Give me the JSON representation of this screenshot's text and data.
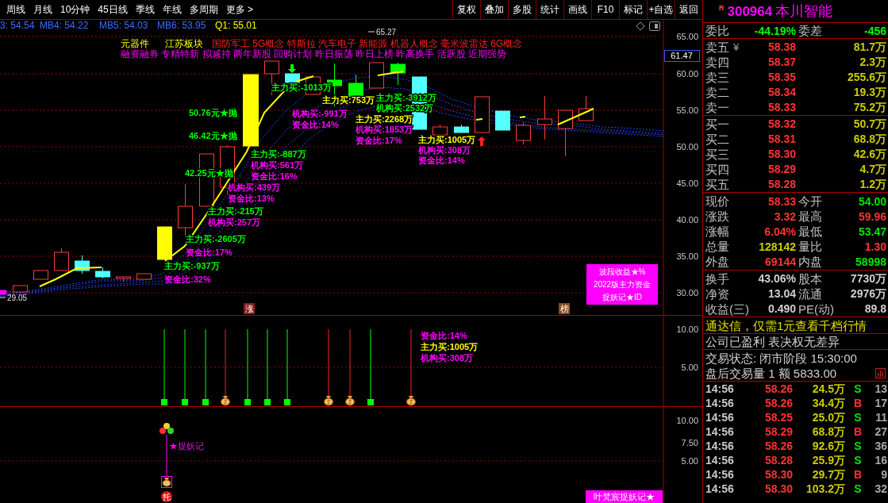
{
  "toolbar": {
    "periods": [
      "周线",
      "月线",
      "10分钟",
      "45日线",
      "季线",
      "年线",
      "多周期",
      "更多 >"
    ],
    "actions": [
      "复权",
      "叠加",
      "多股",
      "统计",
      "画线",
      "F10",
      "标记",
      "+自选",
      "返回"
    ]
  },
  "indicator_line": [
    {
      "text": "3: 54.54",
      "kind": "ma"
    },
    {
      "text": "MB4: 54.22",
      "kind": "ma"
    },
    {
      "text": "MB5: 54.03",
      "kind": "ma"
    },
    {
      "text": "MB6: 53.95",
      "kind": "ma"
    },
    {
      "text": "Q1: 55.01",
      "kind": "q"
    }
  ],
  "price_chart": {
    "axis_labels": [
      "65.00",
      "60.00",
      "55.00",
      "50.00",
      "45.00",
      "40.00",
      "35.00",
      "30.00"
    ],
    "cursor_price": "61.47",
    "high_label": "65.27",
    "low_label": "29.05",
    "sector_tags": [
      {
        "text": "元器件",
        "kind": "industry"
      },
      {
        "text": "江苏板块",
        "kind": "region"
      },
      {
        "text": "国防军工 5G概念 特斯拉 汽车电子 新能源 机器人概念 毫米波雷达 6G概念",
        "kind": "concept"
      }
    ],
    "feature_tags": "融资融券 专精特新 拟减持 两年新股 回购计划 昨日振荡 昨日上榜 昨高换手 活跃股 近期强势",
    "annotations": [
      {
        "text": "主力买:-1013万",
        "color": "#00ff00"
      },
      {
        "text": "主力买:753万",
        "color": "#ffff00"
      },
      {
        "text": "主力买:-3912万",
        "color": "#00ff00"
      },
      {
        "text": "机构买:2532万",
        "color": "#00ff00"
      },
      {
        "text": "50.76元★抛",
        "color": "#00ff00"
      },
      {
        "text": "机构买:-991万",
        "color": "#ff00ff"
      },
      {
        "text": "主力买:2268万",
        "color": "#ffff00"
      },
      {
        "text": "资金比:14%",
        "color": "#ff00ff"
      },
      {
        "text": "机构买:1853万",
        "color": "#ff00ff"
      },
      {
        "text": "46.42元★抛",
        "color": "#00ff00"
      },
      {
        "text": "资金比:17%",
        "color": "#ff00ff"
      },
      {
        "text": "主力买:1005万",
        "color": "#ffff00"
      },
      {
        "text": "机构买:308万",
        "color": "#ff00ff"
      },
      {
        "text": "资金比:14%",
        "color": "#ff00ff"
      },
      {
        "text": "主力买:-887万",
        "color": "#00ff00"
      },
      {
        "text": "机构买:561万",
        "color": "#ff00ff"
      },
      {
        "text": "42.25元★抛",
        "color": "#00ff00"
      },
      {
        "text": "资金比:16%",
        "color": "#ff00ff"
      },
      {
        "text": "机构买:439万",
        "color": "#ff00ff"
      },
      {
        "text": "资金比:13%",
        "color": "#ff00ff"
      },
      {
        "text": "主力买:-215万",
        "color": "#00ff00"
      },
      {
        "text": "机构买:257万",
        "color": "#ff00ff"
      },
      {
        "text": "主力买:-2605万",
        "color": "#00ff00"
      },
      {
        "text": "资金比:17%",
        "color": "#ff00ff"
      },
      {
        "text": "主力买:-937万",
        "color": "#00ff00"
      },
      {
        "text": "资金比:32%",
        "color": "#ff00ff"
      }
    ],
    "event_tags": [
      {
        "text": "涨",
        "color": "#8b1a1a"
      },
      {
        "text": "榜",
        "color": "#8b4a1a"
      }
    ],
    "legend": [
      "波段收益★%",
      "2022版主力资金",
      "捉妖记★ID"
    ]
  },
  "fund_panel": {
    "axis_labels": [
      "10.00",
      "5.00"
    ],
    "labels": [
      {
        "text": "资金比:14%",
        "color": "#ff00ff"
      },
      {
        "text": "主力买:1005万",
        "color": "#ffff00"
      },
      {
        "text": "机构买:308万",
        "color": "#ff00ff"
      }
    ]
  },
  "signal_panel": {
    "axis_labels": [
      "10.00",
      "7.50",
      "5.00"
    ],
    "signal_text": "★捉妖记",
    "marker": "托",
    "footer": "叶梵宸捉妖记★"
  },
  "quote": {
    "flag": "R",
    "code": "300964",
    "name": "本川智能",
    "order_ratio": [
      {
        "label": "委比",
        "value": "-44.19%",
        "color": "#00ff00"
      },
      {
        "label": "委差",
        "value": "-456",
        "color": "#00ff00"
      }
    ],
    "asks": [
      {
        "label": "卖五",
        "mark": "¥",
        "price": "58.38",
        "volume": "81.7万"
      },
      {
        "label": "卖四",
        "price": "58.37",
        "volume": "2.3万"
      },
      {
        "label": "卖三",
        "price": "58.35",
        "volume": "255.6万"
      },
      {
        "label": "卖二",
        "price": "58.34",
        "volume": "19.3万"
      },
      {
        "label": "卖一",
        "price": "58.33",
        "volume": "75.2万"
      }
    ],
    "bids": [
      {
        "label": "买一",
        "price": "58.32",
        "volume": "50.7万"
      },
      {
        "label": "买二",
        "price": "58.31",
        "volume": "68.8万"
      },
      {
        "label": "买三",
        "price": "58.30",
        "volume": "42.6万"
      },
      {
        "label": "买四",
        "price": "58.29",
        "volume": "4.7万"
      },
      {
        "label": "买五",
        "price": "58.28",
        "volume": "1.2万"
      }
    ],
    "stats": [
      {
        "label": "现价",
        "value": "58.33",
        "color": "#ff3232"
      },
      {
        "label": "今开",
        "value": "54.00",
        "color": "#00e600"
      },
      {
        "label": "涨跌",
        "value": "3.32",
        "color": "#ff3232"
      },
      {
        "label": "最高",
        "value": "59.96",
        "color": "#ff3232"
      },
      {
        "label": "涨幅",
        "value": "6.04%",
        "color": "#ff3232"
      },
      {
        "label": "最低",
        "value": "53.47",
        "color": "#00e600"
      },
      {
        "label": "总量",
        "value": "128142",
        "color": "#cccc00"
      },
      {
        "label": "量比",
        "value": "1.30",
        "color": "#ff3232"
      },
      {
        "label": "外盘",
        "value": "69144",
        "color": "#ff3232"
      },
      {
        "label": "内盘",
        "value": "58998",
        "color": "#00e600"
      }
    ],
    "fundamentals": [
      {
        "label": "换手",
        "value": "43.06%"
      },
      {
        "label": "股本",
        "value": "7730万"
      },
      {
        "label": "净资",
        "value": "13.04"
      },
      {
        "label": "流通",
        "value": "2976万"
      },
      {
        "label": "收益(三)",
        "value": "0.490"
      },
      {
        "label": "PE(动)",
        "value": "89.8"
      }
    ],
    "promo": "通达信，仅需1元查看千档行情",
    "company_note": "公司已盈利 表决权无差异",
    "trade_status": "交易状态: 闭市阶段 15:30:00",
    "after_hours": "盘后交易量 1 额 5833.00",
    "ticks": [
      {
        "time": "14:56",
        "price": "58.26",
        "volume": "24.5万",
        "side": "S",
        "kind": "sell",
        "count": "13"
      },
      {
        "time": "14:56",
        "price": "58.26",
        "volume": "34.4万",
        "side": "B",
        "kind": "buy",
        "count": "17"
      },
      {
        "time": "14:56",
        "price": "58.25",
        "volume": "25.0万",
        "side": "S",
        "kind": "sell",
        "count": "11"
      },
      {
        "time": "14:56",
        "price": "58.29",
        "volume": "68.8万",
        "side": "B",
        "kind": "buy",
        "count": "27"
      },
      {
        "time": "14:56",
        "price": "58.26",
        "volume": "92.6万",
        "side": "S",
        "kind": "sell",
        "count": "36"
      },
      {
        "time": "14:56",
        "price": "58.28",
        "volume": "25.9万",
        "side": "S",
        "kind": "sell",
        "count": "16"
      },
      {
        "time": "14:56",
        "price": "58.30",
        "volume": "29.7万",
        "side": "B",
        "kind": "buy",
        "count": "9"
      },
      {
        "time": "14:56",
        "price": "58.30",
        "volume": "103.2万",
        "side": "S",
        "kind": "sell",
        "count": "32"
      }
    ]
  }
}
